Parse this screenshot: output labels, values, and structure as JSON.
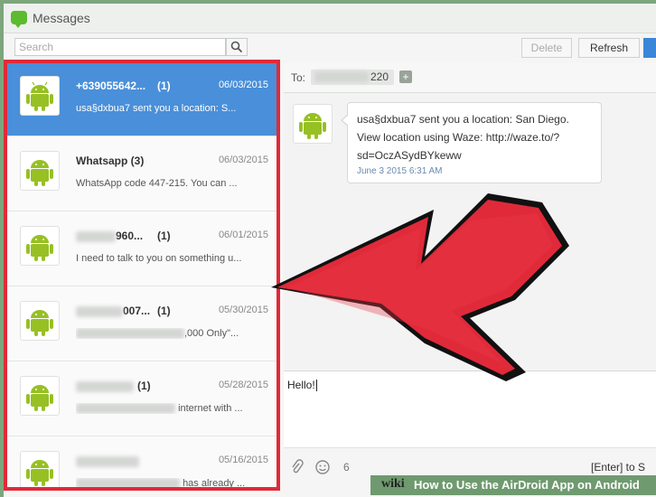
{
  "app": {
    "title": "Messages",
    "icon": "chat-bubble-icon"
  },
  "toolbar": {
    "search_placeholder": "Search",
    "delete_label": "Delete",
    "refresh_label": "Refresh"
  },
  "conversations": [
    {
      "contact": "+639055642...",
      "count": "(1)",
      "date": "06/03/2015",
      "preview": "usa§dxbua7 sent you a location: S...",
      "active": true
    },
    {
      "contact": "Whatsapp (3)",
      "count": "",
      "date": "06/03/2015",
      "preview": "WhatsApp code 447-215. You can ...",
      "active": false
    },
    {
      "contact": "960...",
      "count": "(1)",
      "date": "06/01/2015",
      "preview": "I need to talk to you on something u...",
      "active": false
    },
    {
      "contact": "007...",
      "count": "(1)",
      "date": "05/30/2015",
      "preview": ",000 Only\"...",
      "active": false
    },
    {
      "contact": "",
      "count": "(1)",
      "date": "05/28/2015",
      "preview": "internet with ...",
      "active": false
    },
    {
      "contact": "",
      "count": "",
      "date": "05/16/2015",
      "preview": "has already ...",
      "active": false
    }
  ],
  "to_field": {
    "label": "To:",
    "number_suffix": "220",
    "add_symbol": "+"
  },
  "message": {
    "text_line1": "usa§dxbua7 sent you a location: San Diego.",
    "text_line2": "View location using Waze: http://waze.to/?",
    "text_line3": "sd=OczASydBYkeww",
    "time": "June 3 2015 6:31 AM"
  },
  "compose": {
    "text": "Hello!",
    "char_count": "6",
    "enter_hint": "[Enter] to S"
  },
  "watermark": {
    "wiki": "wiki",
    "how": "How to Use the AirDroid App on Android"
  },
  "colors": {
    "highlight_red": "#e02a3a",
    "active_blue": "#4a8fd9",
    "android_green": "#97c024"
  }
}
